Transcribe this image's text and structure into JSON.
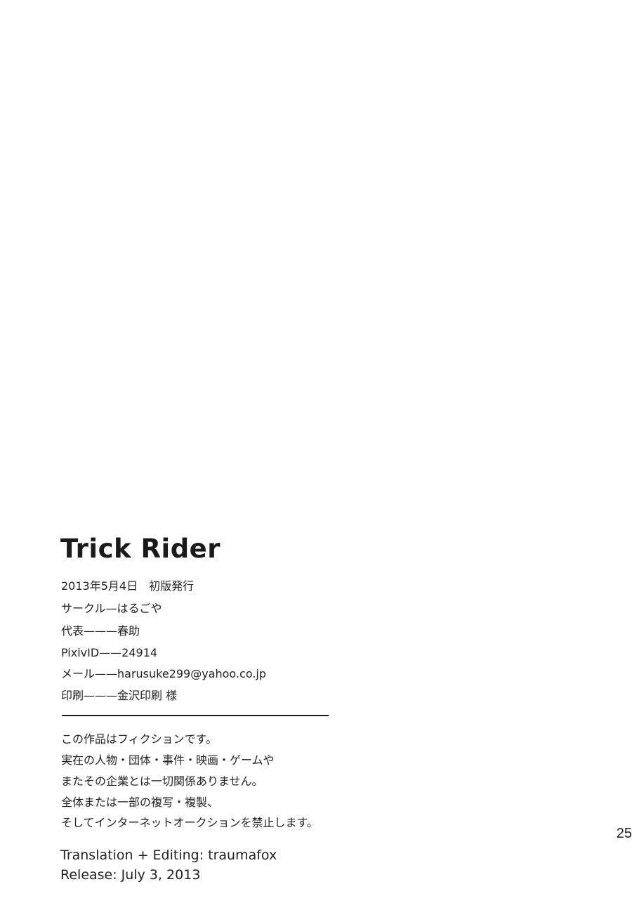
{
  "colophon": {
    "title": "Trick Rider",
    "info": [
      "2013年5月4日　初版発行",
      "サークル—はるごや",
      "代表———春助",
      "PixivID——24914",
      "メール——harusuke299@yahoo.co.jp",
      "印刷———金沢印刷 様"
    ],
    "notice": [
      "この作品はフィクションです。",
      "実在の人物・団体・事件・映画・ゲームや",
      "またその企業とは一切関係ありません。",
      "全体または一部の複写・複製、",
      "そしてインターネットオークションを禁止します。"
    ]
  },
  "page_number": "25",
  "credits": {
    "translation": "Translation + Editing:  traumafox",
    "release": "Release:  July 3, 2013"
  }
}
